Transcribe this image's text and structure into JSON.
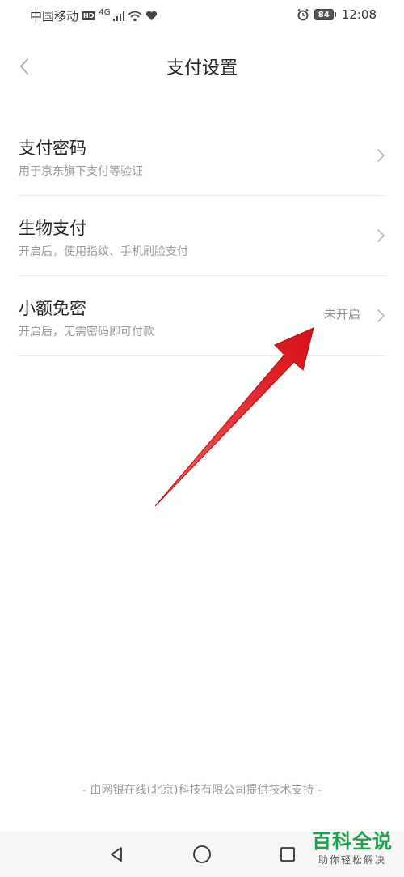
{
  "status_bar": {
    "carrier": "中国移动",
    "hd": "HD",
    "network": "4G",
    "battery": "84",
    "time": "12:08"
  },
  "header": {
    "title": "支付设置"
  },
  "settings": [
    {
      "title": "支付密码",
      "subtitle": "用于京东旗下支付等验证",
      "value": ""
    },
    {
      "title": "生物支付",
      "subtitle": "开启后，使用指纹、手机刷脸支付",
      "value": ""
    },
    {
      "title": "小额免密",
      "subtitle": "开启后，无需密码即可付款",
      "value": "未开启"
    }
  ],
  "footer": {
    "text": "- 由网银在线(北京)科技有限公司提供技术支持 -"
  },
  "watermark": {
    "title": "百科全说",
    "subtitle": "助你轻松解决"
  },
  "colors": {
    "annotation_arrow": "#e8141b",
    "watermark_green": "#1aa34a"
  }
}
